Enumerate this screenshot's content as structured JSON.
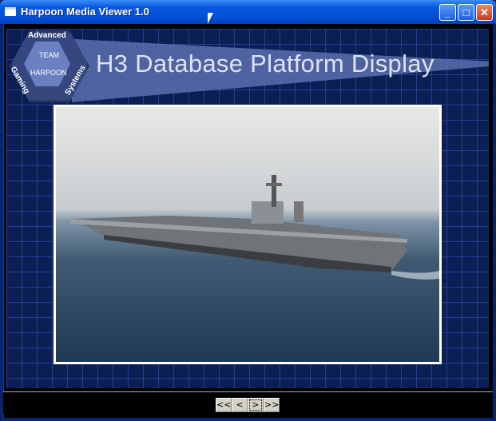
{
  "window": {
    "title": "Harpoon Media Viewer 1.0",
    "minimize": "_",
    "maximize": "□",
    "close": "✕"
  },
  "logo": {
    "top": "Advanced",
    "line1": "TEAM",
    "line2": "HARPOON",
    "left": "Gaming",
    "right": "Systems"
  },
  "header": {
    "title": "H3 Database Platform Display"
  },
  "nav": {
    "first": "<<",
    "prev": "<",
    "next": ">",
    "last": ">>"
  }
}
